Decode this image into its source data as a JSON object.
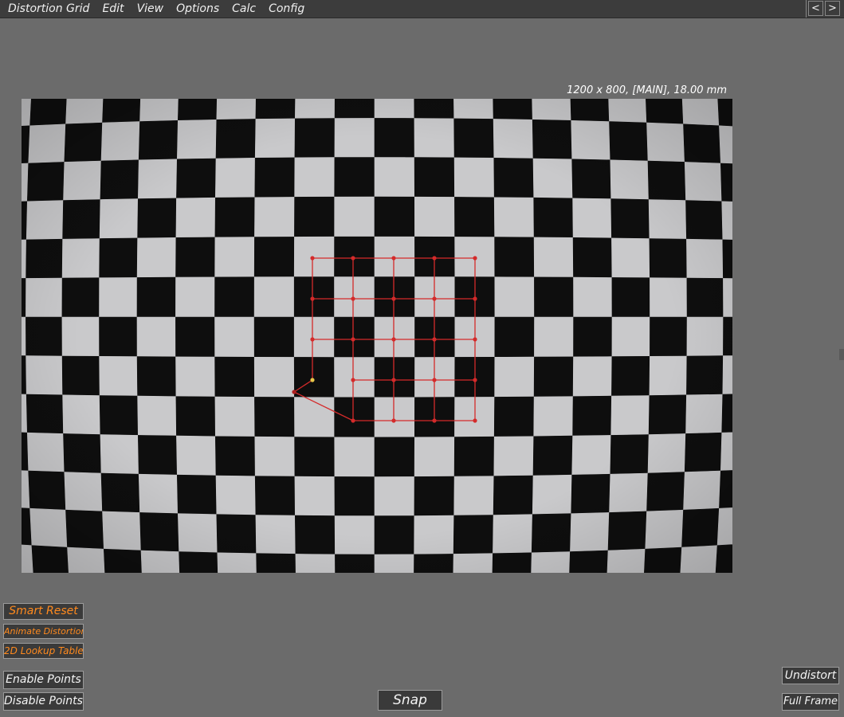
{
  "menubar": {
    "items": [
      "Distortion Grid",
      "Edit",
      "View",
      "Options",
      "Calc",
      "Config"
    ],
    "prev_label": "<",
    "next_label": ">"
  },
  "viewport": {
    "info": "1200 x 800, [MAIN], 18.00 mm",
    "image_size": "1200 x 800",
    "camera": "MAIN",
    "focal_length": "18.00 mm"
  },
  "grid_overlay": {
    "rows": 5,
    "cols": 5,
    "line_color": "#d42a2a",
    "selected_point_color": "#e8c84a"
  },
  "buttons": {
    "smart_reset": "Smart Reset",
    "animate_distortion": "Animate Distortion",
    "lookup_table": "2D Lookup Table",
    "enable_points": "Enable Points",
    "disable_points": "Disable Points",
    "snap": "Snap",
    "undistort": "Undistort",
    "full_frame": "Full Frame"
  },
  "colors": {
    "background": "#6b6b6b",
    "menubar": "#3c3c3c",
    "accent_orange": "#ff8a1e",
    "button_bg": "#3a3a3a"
  }
}
